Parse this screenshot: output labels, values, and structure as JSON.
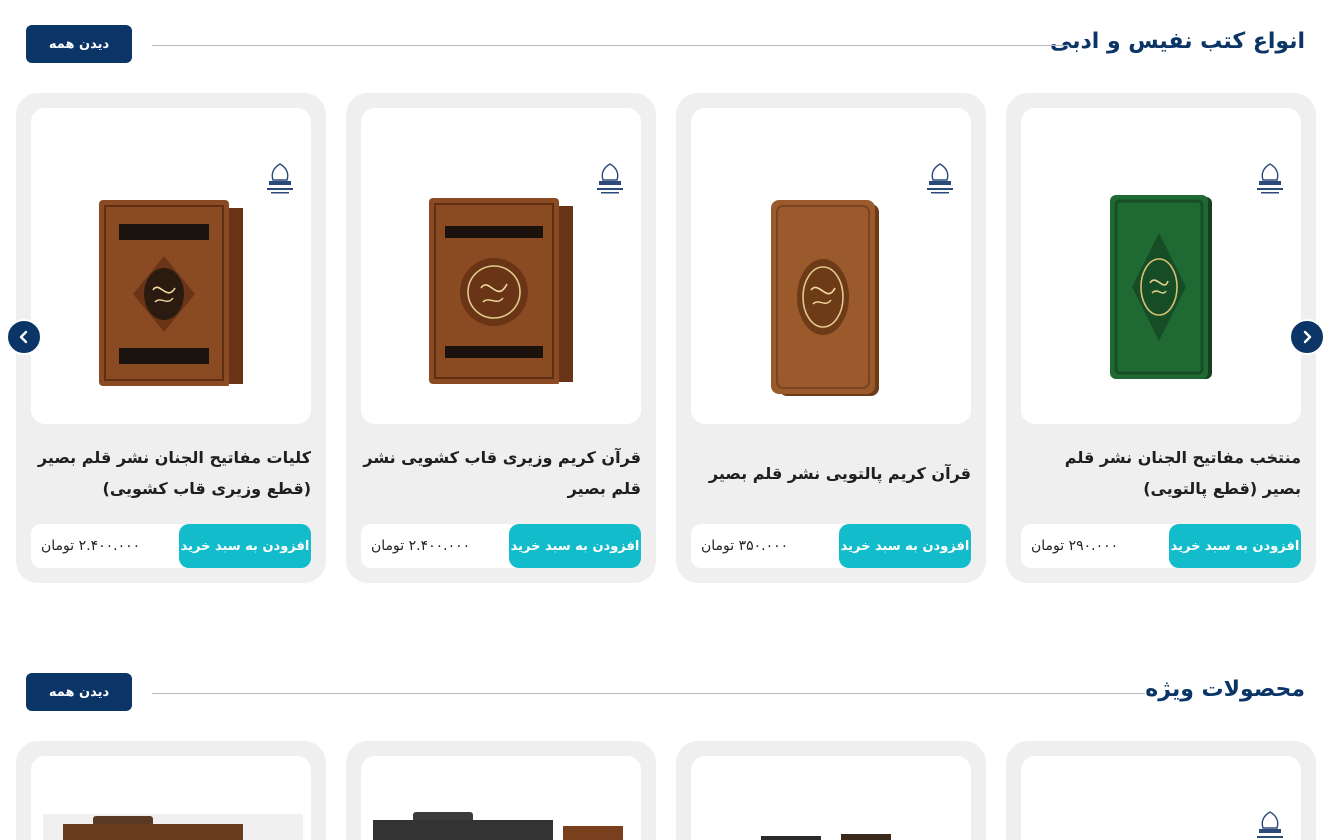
{
  "sections": [
    {
      "title": "انواع کتب نفیس و ادبی",
      "see_all": "دیدن همه"
    },
    {
      "title": "محصولات ویژه",
      "see_all": "دیدن همه"
    }
  ],
  "products": [
    {
      "name": "منتخب مفاتیح الجنان نشر قلم بصیر (قطع پالتویی)",
      "price": "۲۹۰.۰۰۰ تومان",
      "buy_label": "افزودن به سبد خرید",
      "cover_color": "#1f6a32"
    },
    {
      "name": "قرآن کریم پالتویی نشر قلم بصیر",
      "price": "۳۵۰.۰۰۰ تومان",
      "buy_label": "افزودن به سبد خرید",
      "cover_color": "#9a5a2c"
    },
    {
      "name": "قرآن کریم وزیری قاب کشویی نشر قلم بصیر",
      "price": "۲.۴۰۰.۰۰۰ تومان",
      "buy_label": "افزودن به سبد خرید",
      "cover_color": "#8a4a22"
    },
    {
      "name": "کلیات مفاتیح الجنان نشر قلم بصیر (قطع وزیری قاب کشویی)",
      "price": "۲.۴۰۰.۰۰۰ تومان",
      "buy_label": "افزودن به سبد خرید",
      "cover_color": "#8a4a22"
    }
  ],
  "colors": {
    "primary": "#0b3566",
    "accent": "#13bccb",
    "card_bg": "#efefef"
  },
  "icons": {
    "prev": "chevron-left-icon",
    "next": "chevron-right-icon",
    "logo": "publisher-logo-icon"
  }
}
